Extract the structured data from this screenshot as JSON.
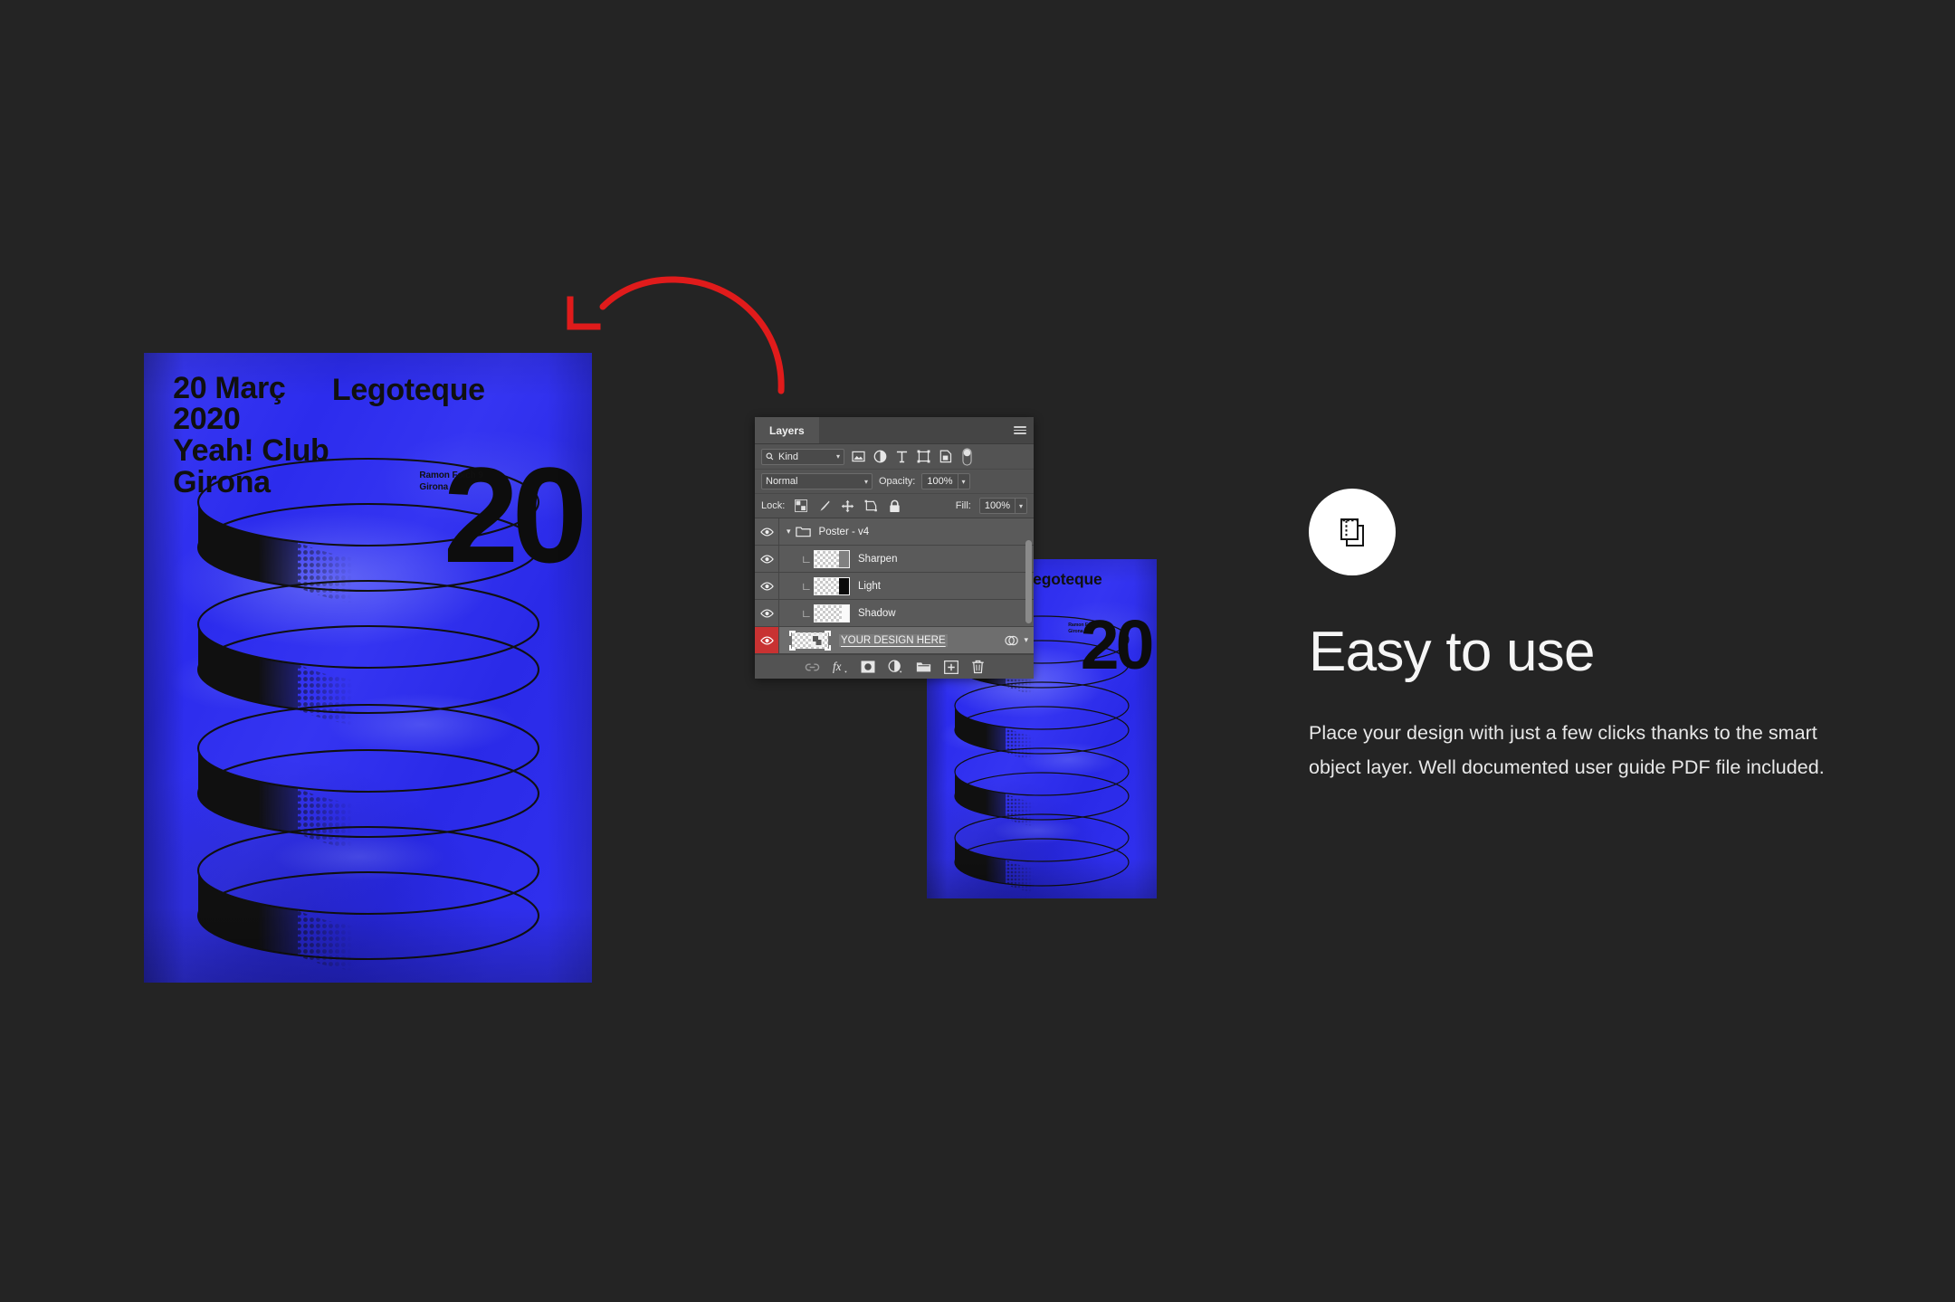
{
  "background_color": "#242424",
  "poster": {
    "color": "#3030ee",
    "headline_line1": "20 Març",
    "headline_line2": "2020",
    "headline_line3": "Yeah! Club",
    "headline_line4": "Girona",
    "brand": "Legoteque",
    "address_line1": "Ramon Folch 9",
    "address_line2": "Girona",
    "big_number": "20"
  },
  "annotation": {
    "arrow_color": "#e01b1b",
    "arrow_name": "curved-arrow-pointing-to-poster"
  },
  "feature": {
    "icon": "duplicate-layers-icon",
    "title": "Easy to use",
    "body": "Place your design with just a few clicks thanks to the smart object layer. Well documented user guide PDF file included."
  },
  "layers_panel": {
    "tab_label": "Layers",
    "menu_icon": "hamburger-menu-icon",
    "filter": {
      "kind_label": "Kind",
      "search_icon": "search-icon",
      "icons": [
        "pixel-layer-filter-icon",
        "adjustment-layer-filter-icon",
        "type-layer-filter-icon",
        "shape-layer-filter-icon",
        "smart-object-filter-icon"
      ],
      "toggle": "filter-enable-toggle"
    },
    "blend": {
      "mode": "Normal",
      "opacity_label": "Opacity:",
      "opacity_value": "100%"
    },
    "lock": {
      "label": "Lock:",
      "icons": [
        "lock-transparent-pixels-icon",
        "lock-image-pixels-icon",
        "lock-position-icon",
        "lock-artboard-nesting-icon",
        "lock-all-icon"
      ],
      "fill_label": "Fill:",
      "fill_value": "100%"
    },
    "layers": [
      {
        "name": "Poster - v4",
        "type": "group",
        "visible": true,
        "selected": false,
        "expanded": true,
        "clipped": false
      },
      {
        "name": "Sharpen",
        "type": "layer",
        "visible": true,
        "selected": false,
        "clipped": true,
        "thumb": "gray"
      },
      {
        "name": "Light",
        "type": "layer",
        "visible": true,
        "selected": false,
        "clipped": true,
        "thumb": "black"
      },
      {
        "name": "Shadow",
        "type": "layer",
        "visible": true,
        "selected": false,
        "clipped": true,
        "thumb": "white"
      },
      {
        "name": "YOUR DESIGN HERE",
        "type": "smart-object",
        "visible": true,
        "selected": true,
        "clipped": false,
        "thumb": "smart-object"
      }
    ],
    "selected_row_color": "#c83232",
    "bottom_icons": [
      "link-layers-icon",
      "layer-style-fx-icon",
      "add-layer-mask-icon",
      "new-adjustment-layer-icon",
      "new-group-icon",
      "new-layer-icon",
      "delete-layer-icon"
    ]
  }
}
